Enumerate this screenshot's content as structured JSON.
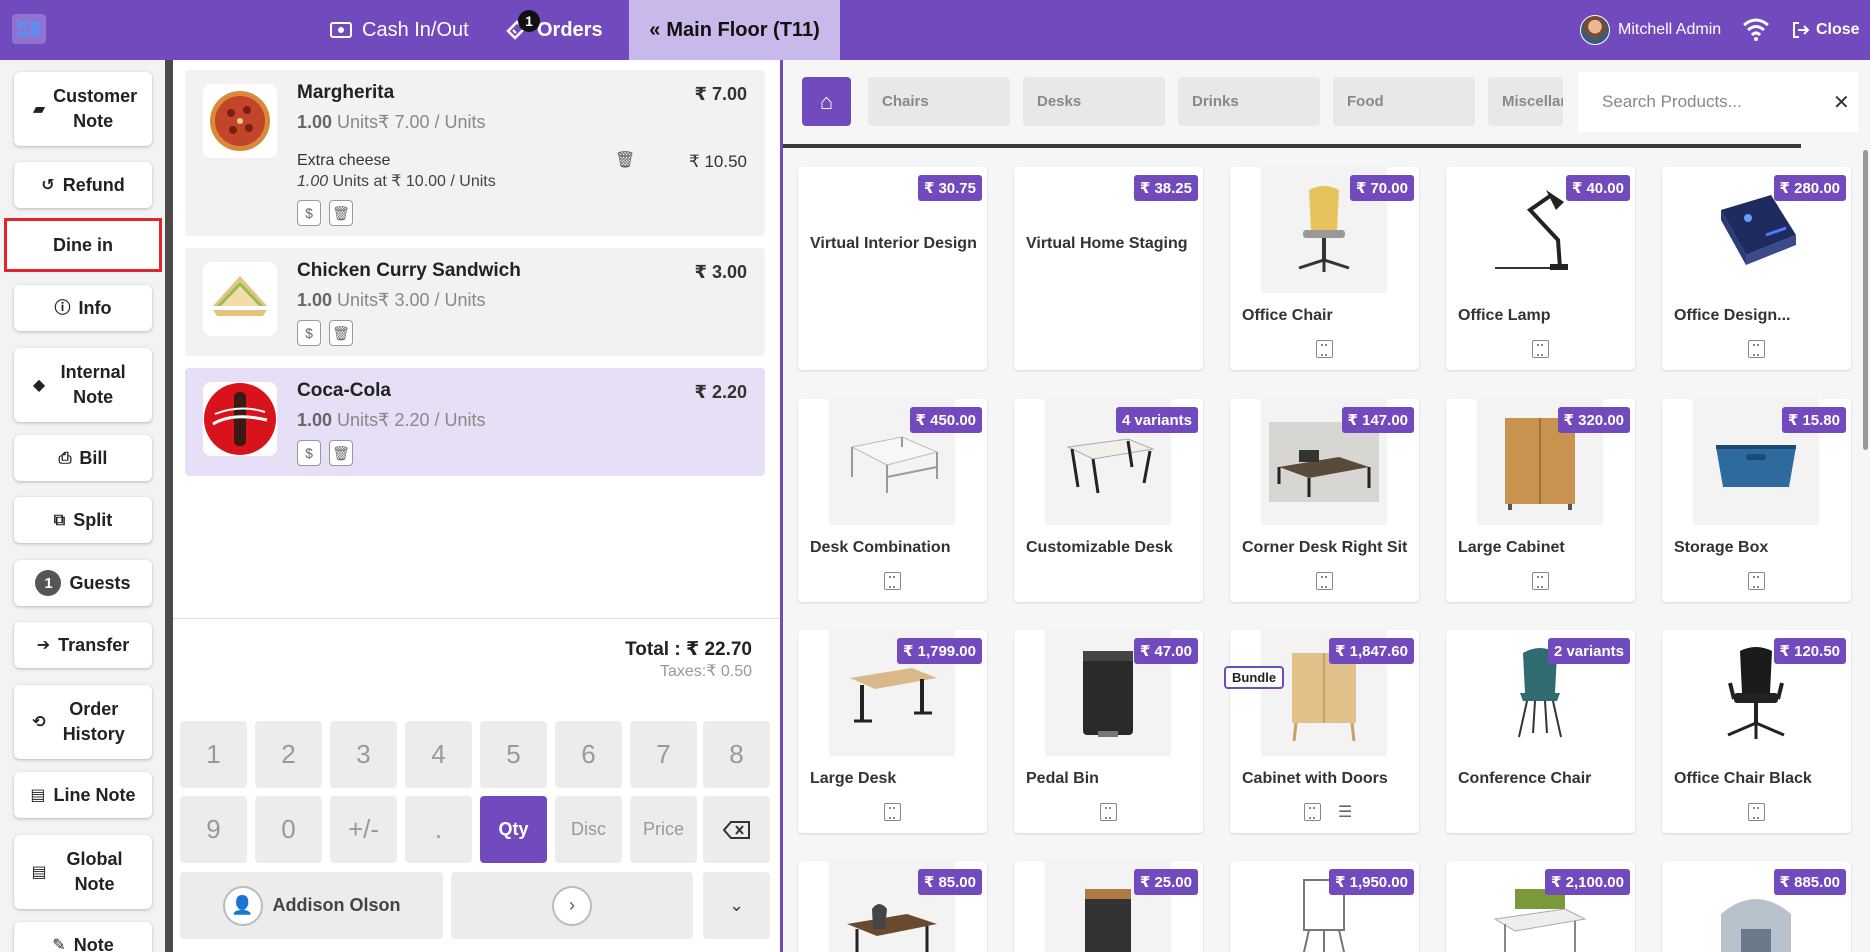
{
  "topbar": {
    "cash_label": "Cash In/Out",
    "orders_label": "Orders",
    "orders_count": "1",
    "floor_label": "Main Floor (T11)",
    "user_name": "Mitchell Admin",
    "close_label": "Close",
    "accent_color": "#714bbe"
  },
  "actions": {
    "customer_note": "Customer Note",
    "refund": "Refund",
    "dine_in": "Dine in",
    "info": "Info",
    "internal_note": "Internal Note",
    "bill": "Bill",
    "split": "Split",
    "guests_count": "1",
    "guests": "Guests",
    "transfer": "Transfer",
    "order_history": "Order History",
    "line_note": "Line Note",
    "global_note": "Global Note",
    "note": "Note"
  },
  "order": {
    "lines": [
      {
        "name": "Margherita",
        "price": "₹ 7.00",
        "qty": "1.00",
        "qty_detail": " Units₹ 7.00 / Units",
        "extra": {
          "name": "Extra cheese",
          "qty": "1.00",
          "detail": " Units at ₹ 10.00 / Units",
          "price": "₹ 10.50"
        }
      },
      {
        "name": "Chicken Curry Sandwich",
        "price": "₹ 3.00",
        "qty": "1.00",
        "qty_detail": " Units₹ 3.00 / Units"
      },
      {
        "name": "Coca-Cola",
        "price": "₹ 2.20",
        "qty": "1.00",
        "qty_detail": " Units₹ 2.20 / Units"
      }
    ],
    "total": "Total : ₹ 22.70",
    "taxes": "Taxes:₹ 0.50"
  },
  "numpad": {
    "keys_row1": [
      "1",
      "2",
      "3",
      "4",
      "5",
      "6",
      "7",
      "8"
    ],
    "keys_row2": [
      "9",
      "0",
      "+/-",
      ".",
      "Qty",
      "Disc",
      "Price"
    ],
    "customer": "Addison Olson"
  },
  "categories": [
    "Chairs",
    "Desks",
    "Drinks",
    "Food",
    "Miscellaneous"
  ],
  "search": {
    "placeholder": "Search Products..."
  },
  "products": [
    {
      "name": "Virtual Interior Design",
      "price": "₹ 30.75"
    },
    {
      "name": "Virtual Home Staging",
      "price": "₹ 38.25"
    },
    {
      "name": "Office Chair",
      "price": "₹ 70.00"
    },
    {
      "name": "Office Lamp",
      "price": "₹ 40.00"
    },
    {
      "name": "Office Design...",
      "price": "₹ 280.00"
    },
    {
      "name": "Desk Combination",
      "price": "₹ 450.00"
    },
    {
      "name": "Customizable Desk",
      "price": "4 variants"
    },
    {
      "name": "Corner Desk Right Sit",
      "price": "₹ 147.00"
    },
    {
      "name": "Large Cabinet",
      "price": "₹ 320.00"
    },
    {
      "name": "Storage Box",
      "price": "₹ 15.80"
    },
    {
      "name": "Large Desk",
      "price": "₹ 1,799.00"
    },
    {
      "name": "Pedal Bin",
      "price": "₹ 47.00"
    },
    {
      "name": "Cabinet with Doors",
      "price": "₹ 1,847.60",
      "tag": "Bundle"
    },
    {
      "name": "Conference Chair",
      "price": "2 variants"
    },
    {
      "name": "Office Chair Black",
      "price": "₹ 120.50"
    },
    {
      "price": "₹ 85.00"
    },
    {
      "price": "₹ 25.00"
    },
    {
      "price": "₹ 1,950.00"
    },
    {
      "price": "₹ 2,100.00"
    },
    {
      "price": "₹ 885.00"
    }
  ]
}
